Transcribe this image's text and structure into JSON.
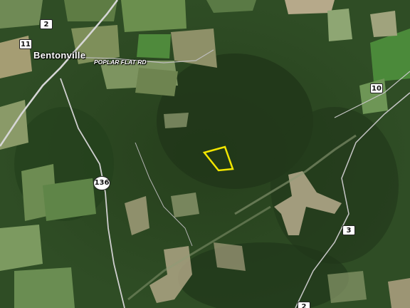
{
  "map": {
    "type": "satellite",
    "town_label": "Bentonville",
    "road_label": "POPLAR FLAT RD",
    "route_shields": [
      {
        "id": "route-2-north",
        "number": "2",
        "style": "state"
      },
      {
        "id": "route-11",
        "number": "11",
        "style": "state"
      },
      {
        "id": "route-10",
        "number": "10",
        "style": "state"
      },
      {
        "id": "route-136",
        "number": "136",
        "style": "oval"
      },
      {
        "id": "route-3",
        "number": "3",
        "style": "state"
      },
      {
        "id": "route-2-south",
        "number": "2",
        "style": "state"
      }
    ],
    "parcel_outline_color": "#f2e600",
    "colors": {
      "forest": "#2c4a22",
      "field": "#6f8a55",
      "clearing": "#b8ad8e",
      "road": "#d9d9d9"
    }
  }
}
